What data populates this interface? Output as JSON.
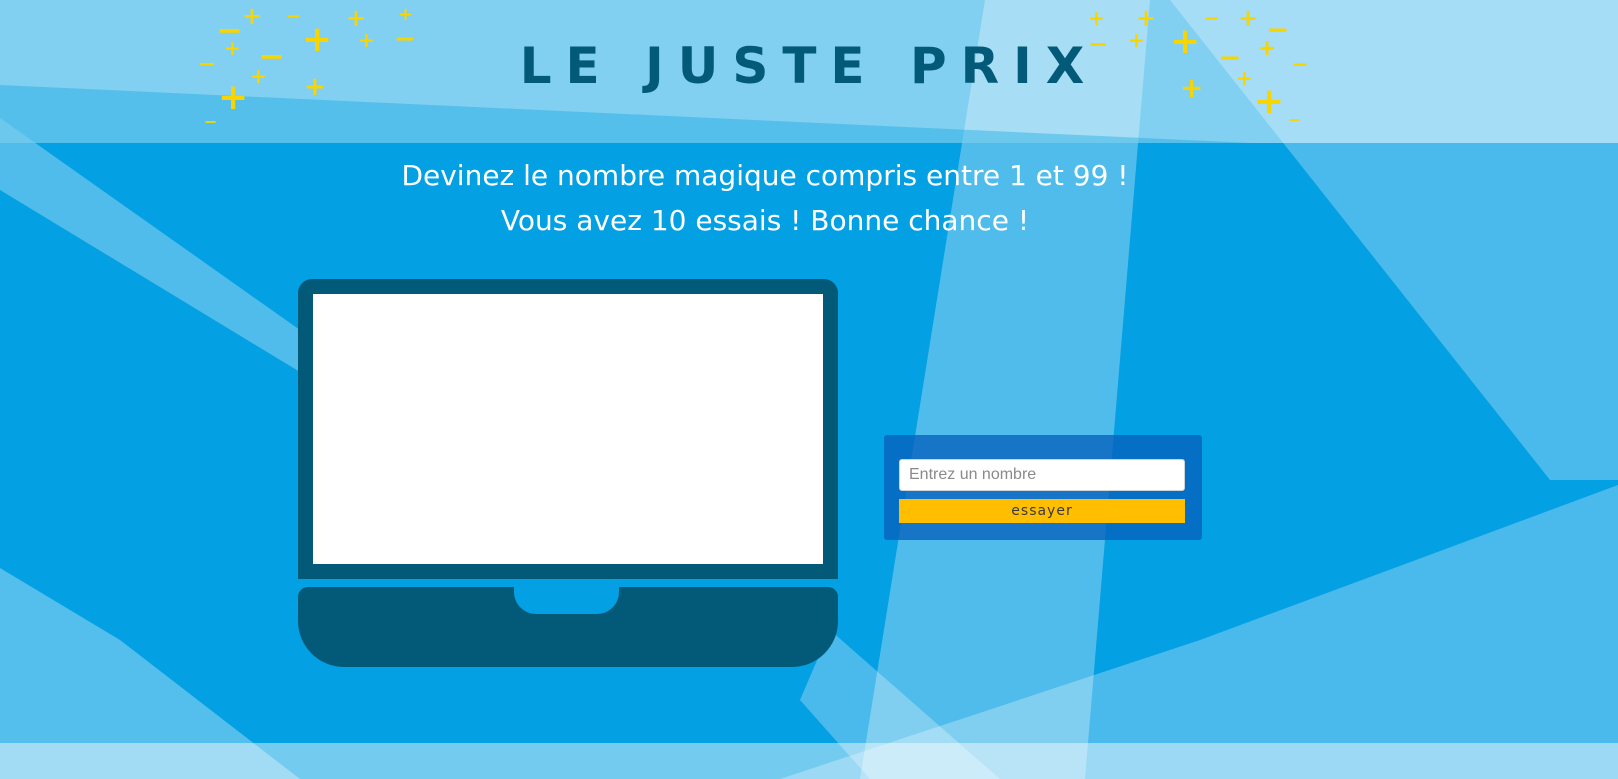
{
  "header": {
    "title": "LE JUSTE PRIX"
  },
  "intro": {
    "line1": "Devinez le nombre magique compris entre 1 et 99 !",
    "line2": "Vous avez 10 essais ! Bonne chance !"
  },
  "guess_form": {
    "input_value": "",
    "input_placeholder": "Entrez un nombre",
    "submit_label": "essayer"
  },
  "colors": {
    "background": "#03a0e3",
    "title": "#035a78",
    "laptop": "#035a78",
    "decoration": "#f8d400",
    "button": "#ffbf00",
    "form_panel": "#0762bd"
  },
  "icons": {
    "decoration_left": "plus-minus-symbols-icon",
    "decoration_right": "plus-minus-symbols-icon",
    "laptop": "laptop-icon"
  }
}
